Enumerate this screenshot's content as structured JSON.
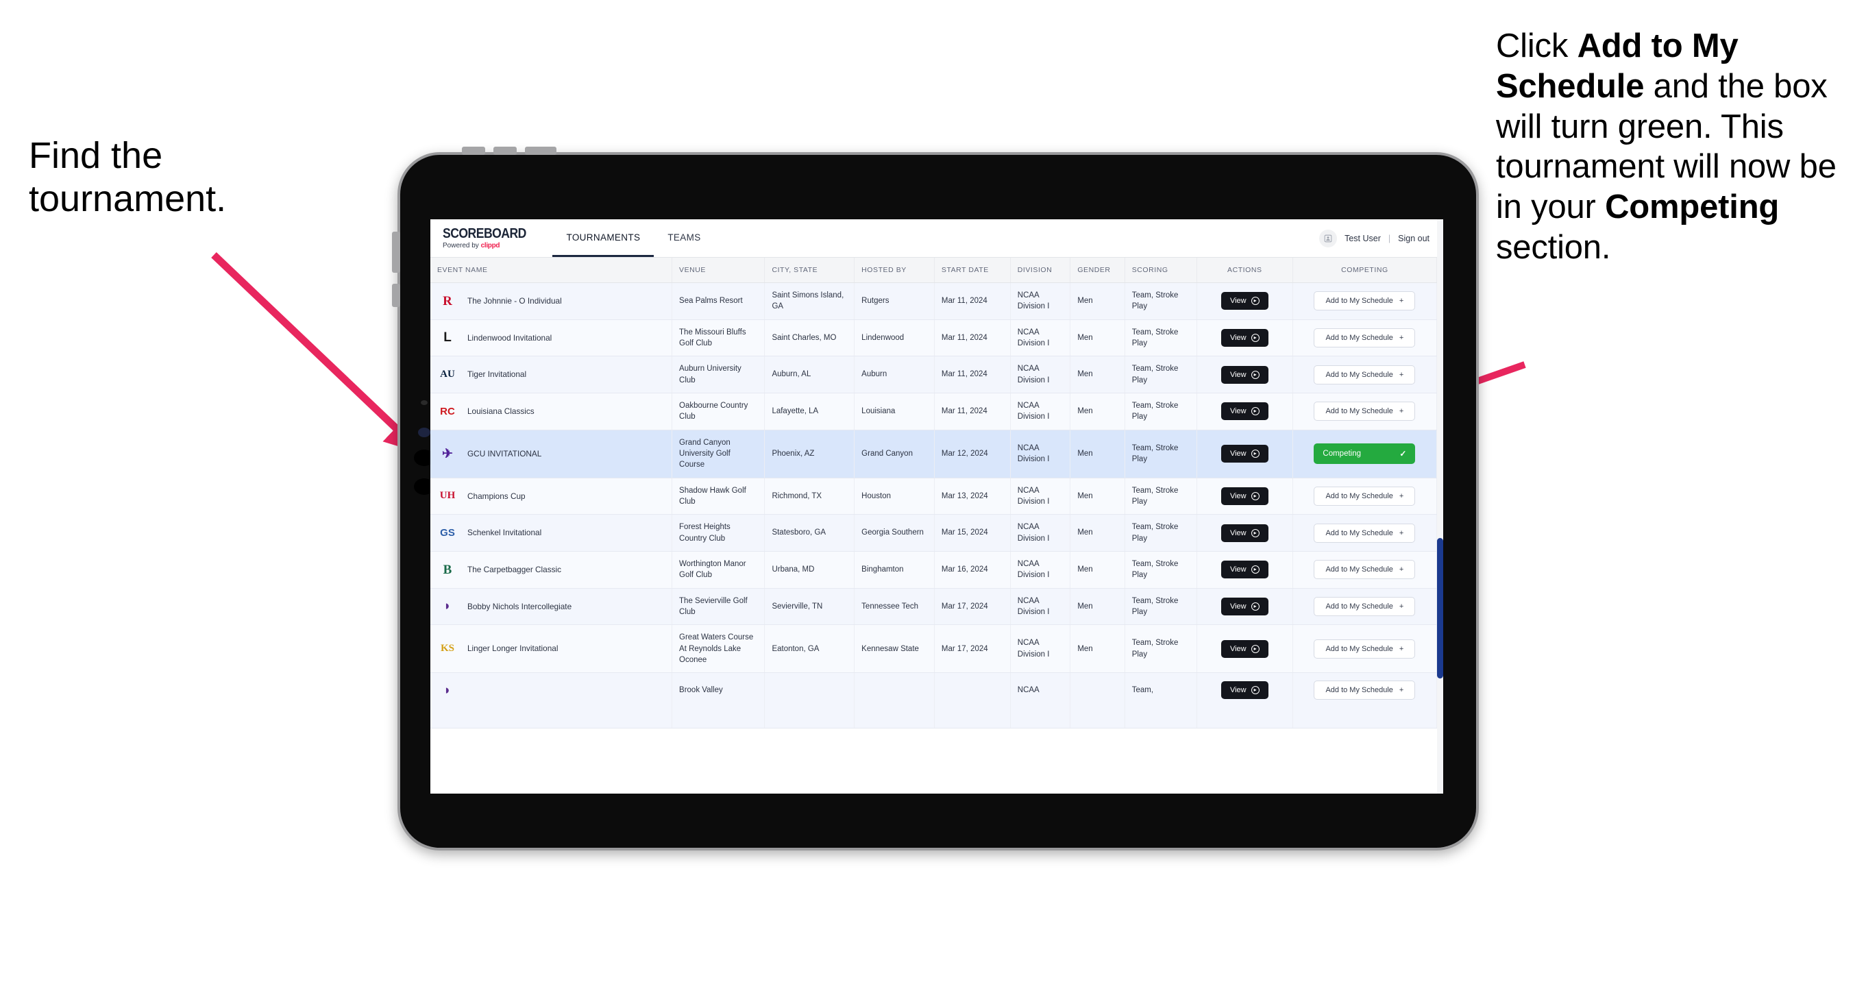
{
  "annotations": {
    "left": "Find the\ntournament.",
    "right_parts": [
      {
        "t": "Click ",
        "b": false
      },
      {
        "t": "Add to My Schedule",
        "b": true
      },
      {
        "t": " and the box will turn green. This tournament will now be in your ",
        "b": false
      },
      {
        "t": "Competing",
        "b": true
      },
      {
        "t": " section.",
        "b": false
      }
    ],
    "arrow_color": "#e8265e"
  },
  "app": {
    "brand": {
      "title": "SCOREBOARD",
      "powered_prefix": "Powered by ",
      "powered_brand": "clippd"
    },
    "nav_tabs": [
      {
        "label": "TOURNAMENTS",
        "active": true
      },
      {
        "label": "TEAMS",
        "active": false
      }
    ],
    "account": {
      "avatar_icon": "user-avatar-icon",
      "user_name": "Test User",
      "separator": "|",
      "sign_out": "Sign out"
    }
  },
  "table": {
    "columns": [
      {
        "key": "event",
        "label": "EVENT NAME",
        "align": "left",
        "cls": "col-event"
      },
      {
        "key": "venue",
        "label": "VENUE",
        "align": "left",
        "cls": "col-venue"
      },
      {
        "key": "city",
        "label": "CITY, STATE",
        "align": "left",
        "cls": "col-city"
      },
      {
        "key": "host",
        "label": "HOSTED BY",
        "align": "left",
        "cls": "col-host"
      },
      {
        "key": "date",
        "label": "START DATE",
        "align": "left",
        "cls": "col-date"
      },
      {
        "key": "div",
        "label": "DIVISION",
        "align": "left",
        "cls": "col-div"
      },
      {
        "key": "gender",
        "label": "GENDER",
        "align": "left",
        "cls": "col-gender"
      },
      {
        "key": "scoring",
        "label": "SCORING",
        "align": "left",
        "cls": "col-scoring"
      },
      {
        "key": "actions",
        "label": "ACTIONS",
        "align": "center",
        "cls": "col-actions"
      },
      {
        "key": "compete",
        "label": "COMPETING",
        "align": "center",
        "cls": "col-compete"
      }
    ],
    "view_button_label": "View",
    "add_button_label": "Add to My Schedule",
    "add_button_icon": "plus-icon",
    "competing_button_label": "Competing",
    "competing_button_icon": "check-icon",
    "rows": [
      {
        "event": "The Johnnie - O Individual",
        "venue": "Sea Palms Resort",
        "city": "Saint Simons Island, GA",
        "host": "Rutgers",
        "date": "Mar 11, 2024",
        "div": "NCAA Division I",
        "gender": "Men",
        "scoring": "Team, Stroke Play",
        "competing": false,
        "logo": {
          "text": "R",
          "color": "#c8102e",
          "bg": "transparent",
          "font": "serif"
        }
      },
      {
        "event": "Lindenwood Invitational",
        "venue": "The Missouri Bluffs Golf Club",
        "city": "Saint Charles, MO",
        "host": "Lindenwood",
        "date": "Mar 11, 2024",
        "div": "NCAA Division I",
        "gender": "Men",
        "scoring": "Team, Stroke Play",
        "competing": false,
        "logo": {
          "text": "L",
          "color": "#1a1a1a",
          "bg": "transparent",
          "font": "sans"
        }
      },
      {
        "event": "Tiger Invitational",
        "venue": "Auburn University Club",
        "city": "Auburn, AL",
        "host": "Auburn",
        "date": "Mar 11, 2024",
        "div": "NCAA Division I",
        "gender": "Men",
        "scoring": "Team, Stroke Play",
        "competing": false,
        "logo": {
          "text": "AU",
          "color": "#0c2340",
          "bg": "transparent",
          "font": "serif"
        }
      },
      {
        "event": "Louisiana Classics",
        "venue": "Oakbourne Country Club",
        "city": "Lafayette, LA",
        "host": "Louisiana",
        "date": "Mar 11, 2024",
        "div": "NCAA Division I",
        "gender": "Men",
        "scoring": "Team, Stroke Play",
        "competing": false,
        "logo": {
          "text": "RC",
          "color": "#ce181e",
          "bg": "transparent",
          "font": "sans"
        }
      },
      {
        "event": "GCU INVITATIONAL",
        "venue": "Grand Canyon University Golf Course",
        "city": "Phoenix, AZ",
        "host": "Grand Canyon",
        "date": "Mar 12, 2024",
        "div": "NCAA Division I",
        "gender": "Men",
        "scoring": "Team, Stroke Play",
        "competing": true,
        "selected": true,
        "logo": {
          "text": "✈",
          "color": "#522398",
          "bg": "transparent",
          "font": "sans"
        }
      },
      {
        "event": "Champions Cup",
        "venue": "Shadow Hawk Golf Club",
        "city": "Richmond, TX",
        "host": "Houston",
        "date": "Mar 13, 2024",
        "div": "NCAA Division I",
        "gender": "Men",
        "scoring": "Team, Stroke Play",
        "competing": false,
        "logo": {
          "text": "UH",
          "color": "#c8102e",
          "bg": "transparent",
          "font": "serif"
        }
      },
      {
        "event": "Schenkel Invitational",
        "venue": "Forest Heights Country Club",
        "city": "Statesboro, GA",
        "host": "Georgia Southern",
        "date": "Mar 15, 2024",
        "div": "NCAA Division I",
        "gender": "Men",
        "scoring": "Team, Stroke Play",
        "competing": false,
        "logo": {
          "text": "GS",
          "color": "#2c5ea8",
          "bg": "transparent",
          "font": "sans"
        }
      },
      {
        "event": "The Carpetbagger Classic",
        "venue": "Worthington Manor Golf Club",
        "city": "Urbana, MD",
        "host": "Binghamton",
        "date": "Mar 16, 2024",
        "div": "NCAA Division I",
        "gender": "Men",
        "scoring": "Team, Stroke Play",
        "competing": false,
        "logo": {
          "text": "B",
          "color": "#1a6b4a",
          "bg": "transparent",
          "font": "serif"
        }
      },
      {
        "event": "Bobby Nichols Intercollegiate",
        "venue": "The Sevierville Golf Club",
        "city": "Sevierville, TN",
        "host": "Tennessee Tech",
        "date": "Mar 17, 2024",
        "div": "NCAA Division I",
        "gender": "Men",
        "scoring": "Team, Stroke Play",
        "competing": false,
        "logo": {
          "text": "◗",
          "color": "#5b2d8e",
          "bg": "transparent",
          "font": "sans"
        }
      },
      {
        "event": "Linger Longer Invitational",
        "venue": "Great Waters Course At Reynolds Lake Oconee",
        "city": "Eatonton, GA",
        "host": "Kennesaw State",
        "date": "Mar 17, 2024",
        "div": "NCAA Division I",
        "gender": "Men",
        "scoring": "Team, Stroke Play",
        "competing": false,
        "logo": {
          "text": "KS",
          "color": "#d4a017",
          "bg": "transparent",
          "font": "serif"
        }
      },
      {
        "event": "",
        "venue": "Brook Valley",
        "city": "",
        "host": "",
        "date": "",
        "div": "NCAA",
        "gender": "",
        "scoring": "Team,",
        "competing": false,
        "clipped": true,
        "logo": {
          "text": "◗",
          "color": "#5b2d8e",
          "bg": "transparent",
          "font": "sans"
        }
      }
    ]
  }
}
